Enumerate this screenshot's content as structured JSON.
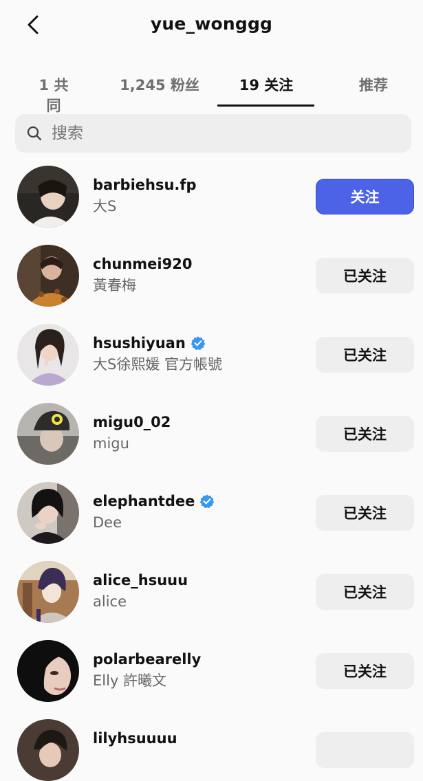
{
  "header": {
    "title": "yue_wonggg"
  },
  "tabs": [
    {
      "label": "1 共同"
    },
    {
      "label": "1,245 粉丝"
    },
    {
      "label": "19 关注"
    },
    {
      "label": "推荐"
    }
  ],
  "search": {
    "placeholder": "搜索"
  },
  "users": [
    {
      "username": "barbiehsu.fp",
      "display_name": "大S",
      "verified": false,
      "button": "关注"
    },
    {
      "username": "chunmei920",
      "display_name": "黃春梅",
      "verified": false,
      "button": "已关注"
    },
    {
      "username": "hsushiyuan",
      "display_name": "大S徐熙媛 官方帳號",
      "verified": true,
      "button": "已关注"
    },
    {
      "username": "migu0_02",
      "display_name": "migu",
      "verified": false,
      "button": "已关注"
    },
    {
      "username": "elephantdee",
      "display_name": "Dee",
      "verified": true,
      "button": "已关注"
    },
    {
      "username": "alice_hsuuu",
      "display_name": "alice",
      "verified": false,
      "button": "已关注"
    },
    {
      "username": "polarbearelly",
      "display_name": "Elly 許曦文",
      "verified": false,
      "button": "已关注"
    },
    {
      "username": "lilyhsuuuu",
      "display_name": "",
      "verified": false,
      "button": ""
    }
  ],
  "colors": {
    "primary_button": "#4c63e8",
    "secondary_button": "#eeeeef",
    "verified_badge": "#3897f0"
  }
}
